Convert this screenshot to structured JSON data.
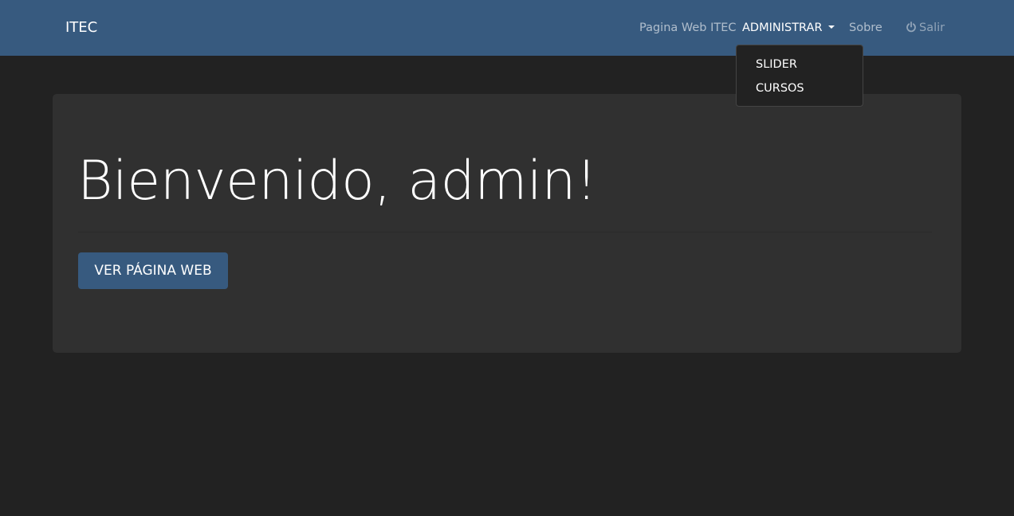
{
  "navbar": {
    "brand": "ITEC",
    "links": {
      "web": "Pagina Web ITEC",
      "admin": "ADMINISTRAR",
      "about": "Sobre",
      "logout": "Salir"
    },
    "logout_icon": "power-icon",
    "background": "#375a7f"
  },
  "dropdown": {
    "items": [
      "SLIDER",
      "CURSOS"
    ]
  },
  "jumbotron": {
    "heading": "Bienvenido, admin!",
    "button_label": "VER PÁGINA WEB"
  },
  "colors": {
    "page_background": "#222222",
    "panel_background": "#303030",
    "primary": "#375a7f"
  }
}
